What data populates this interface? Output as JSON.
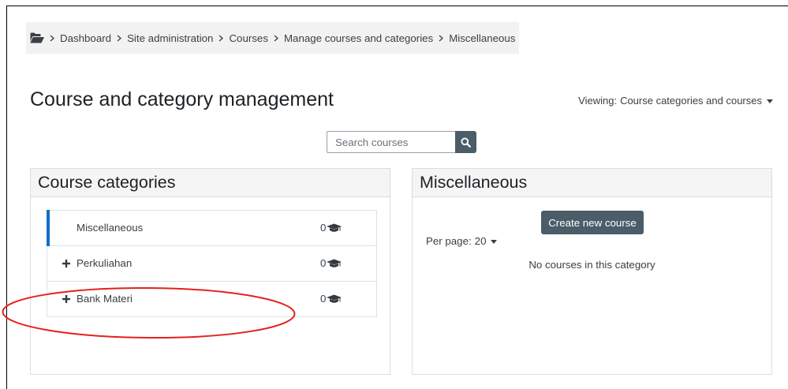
{
  "breadcrumb": {
    "items": [
      "Dashboard",
      "Site administration",
      "Courses",
      "Manage courses and categories",
      "Miscellaneous"
    ]
  },
  "page_title": "Course and category management",
  "viewing": {
    "label": "Viewing:",
    "value": "Course categories and courses"
  },
  "search": {
    "placeholder": "Search courses"
  },
  "categories_panel": {
    "title": "Course categories",
    "items": [
      {
        "name": "Miscellaneous",
        "course_count": "0",
        "expandable": false,
        "active": true
      },
      {
        "name": "Perkuliahan",
        "course_count": "0",
        "expandable": true,
        "active": false
      },
      {
        "name": "Bank Materi",
        "course_count": "0",
        "expandable": true,
        "active": false
      }
    ]
  },
  "courses_panel": {
    "title": "Miscellaneous",
    "create_button": "Create new course",
    "per_page": {
      "label": "Per page:",
      "value": "20"
    },
    "empty_message": "No courses in this category"
  },
  "icons": {
    "breadcrumb_home": "folder-open-icon",
    "breadcrumb_separator": "chevron-right-icon",
    "search": "search-icon",
    "expand": "plus-icon",
    "course_count": "graduation-cap-icon",
    "dropdown": "caret-down-icon"
  },
  "colors": {
    "active_indicator": "#0f6fc6",
    "button_background": "#4a5d68",
    "annotation_ellipse": "#e3211c"
  }
}
